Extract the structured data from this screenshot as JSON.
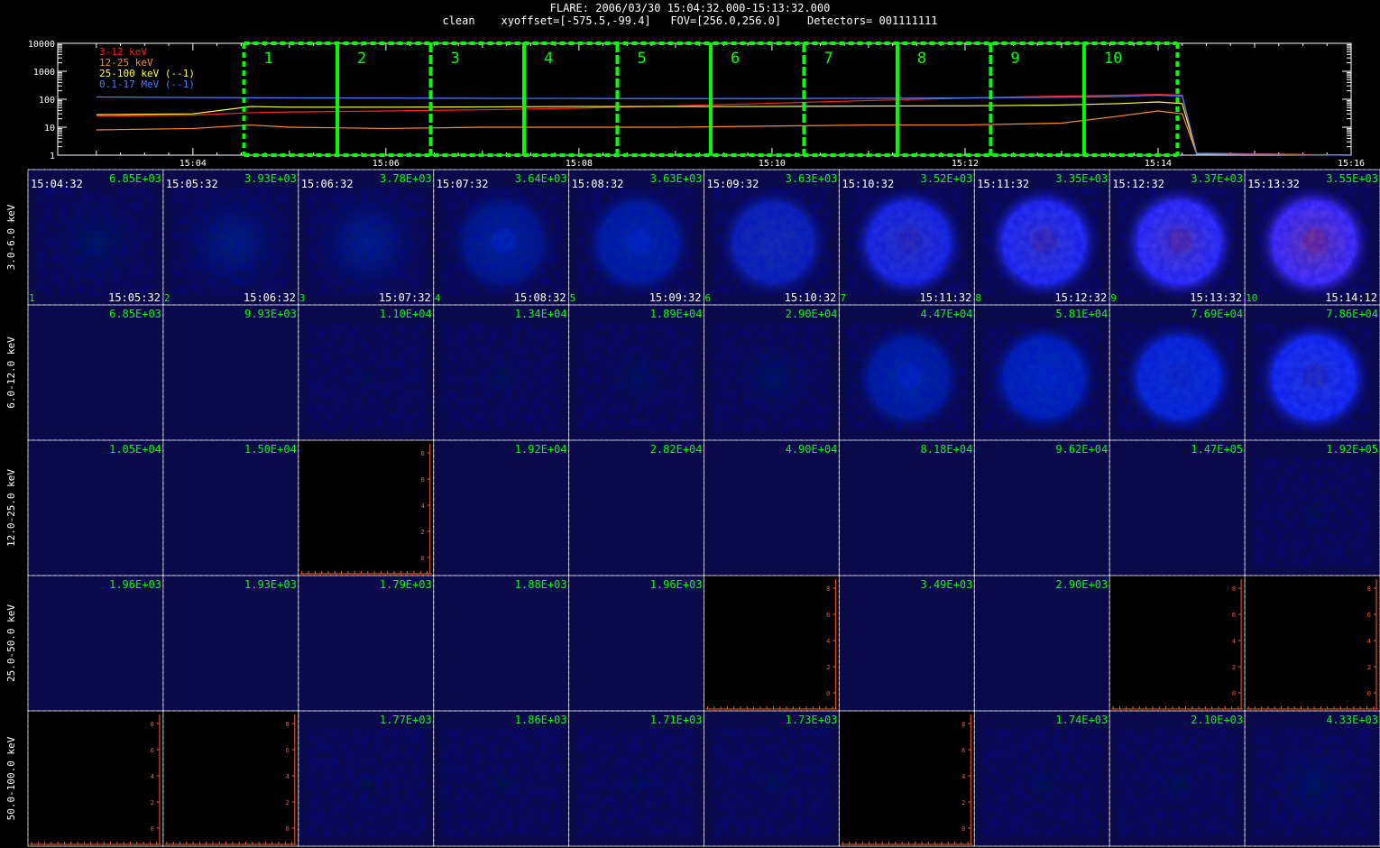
{
  "header": {
    "line1": "FLARE: 2006/03/30 15:04:32.000-15:13:32.000",
    "line2": "clean    xyoffset=[-575.5,-99.4]   FOV=[256.0,256.0]    Detectors= 001111111"
  },
  "colors": {
    "bg": "#000000",
    "green": "#00ff00",
    "red": "#ff2020",
    "orange": "#ff8c20",
    "yellow": "#ffff40",
    "blue": "#4a7cff",
    "imgbg": "#0a0a4a",
    "tick": "#ff5a20"
  },
  "chart_data": [
    {
      "type": "line",
      "yscale": "log",
      "ylim": [
        1,
        10000
      ],
      "yticks": [
        "10000",
        "1000",
        "100",
        "10",
        "1"
      ],
      "xticks": [
        "15:04",
        "15:06",
        "15:08",
        "15:10",
        "15:12",
        "15:14",
        "15:16"
      ],
      "x_minutes": [
        3.0,
        4.0,
        4.6,
        5.0,
        6.0,
        7.0,
        8.0,
        9.0,
        10.0,
        11.0,
        12.0,
        13.0,
        13.6,
        14.0,
        14.25,
        14.4,
        16.0
      ],
      "series": [
        {
          "name": "3-12 keV",
          "color": "#ff2020",
          "values": [
            25,
            27,
            33,
            35,
            38,
            42,
            48,
            58,
            72,
            90,
            110,
            130,
            140,
            150,
            140,
            1.2,
            1
          ]
        },
        {
          "name": "12-25 keV",
          "color": "#ff8c20",
          "values": [
            8,
            9,
            12,
            10,
            9,
            10,
            10,
            10,
            11,
            12,
            12,
            14,
            25,
            38,
            30,
            1.1,
            1
          ]
        },
        {
          "name": "25-100 keV (--1)",
          "color": "#ffff40",
          "values": [
            28,
            30,
            55,
            52,
            52,
            53,
            55,
            55,
            55,
            57,
            58,
            62,
            70,
            80,
            70,
            1.1,
            1
          ]
        },
        {
          "name": "0.1-17 MeV (--1)",
          "color": "#4a7cff",
          "values": [
            120,
            115,
            113,
            112,
            110,
            108,
            107,
            106,
            106,
            108,
            112,
            118,
            125,
            140,
            130,
            1.1,
            1
          ]
        }
      ],
      "intervals": [
        "1",
        "2",
        "3",
        "4",
        "5",
        "6",
        "7",
        "8",
        "9",
        "10"
      ]
    },
    {
      "type": "heatmap",
      "energy_bands": [
        "3.0-6.0 keV",
        "6.0-12.0 keV",
        "12.0-25.0 keV",
        "25.0-50.0 keV",
        "50.0-100.0 keV"
      ],
      "interval_numbers": [
        "1",
        "2",
        "3",
        "4",
        "5",
        "6",
        "7",
        "8",
        "9",
        "10"
      ],
      "start_times": [
        "15:04:32",
        "15:05:32",
        "15:06:32",
        "15:07:32",
        "15:08:32",
        "15:09:32",
        "15:10:32",
        "15:11:32",
        "15:12:32",
        "15:13:32"
      ],
      "end_times": [
        "15:05:32",
        "15:06:32",
        "15:07:32",
        "15:08:32",
        "15:09:32",
        "15:10:32",
        "15:11:32",
        "15:12:32",
        "15:13:32",
        "15:14:12"
      ],
      "peak_values": [
        [
          "6.85E+03",
          "3.93E+03",
          "3.78E+03",
          "3.64E+03",
          "3.63E+03",
          "3.63E+03",
          "3.52E+03",
          "3.35E+03",
          "3.37E+03",
          "3.55E+03"
        ],
        [
          "6.85E+03",
          "9.93E+03",
          "1.10E+04",
          "1.34E+04",
          "1.89E+04",
          "2.90E+04",
          "4.47E+04",
          "5.81E+04",
          "7.69E+04",
          "7.86E+04"
        ],
        [
          "1.05E+04",
          "1.50E+04",
          "",
          "1.92E+04",
          "2.82E+04",
          "4.90E+04",
          "8.18E+04",
          "9.62E+04",
          "1.47E+05",
          "1.92E+05"
        ],
        [
          "1.96E+03",
          "1.93E+03",
          "1.79E+03",
          "1.88E+03",
          "1.96E+03",
          "",
          "3.49E+03",
          "2.90E+03",
          "",
          ""
        ],
        [
          "",
          "",
          "1.77E+03",
          "1.86E+03",
          "1.71E+03",
          "1.73E+03",
          "",
          "1.74E+03",
          "2.10E+03",
          "4.33E+03"
        ]
      ],
      "empty_panels": [
        [
          2,
          2
        ],
        [
          3,
          5
        ],
        [
          3,
          8
        ],
        [
          3,
          9
        ],
        [
          4,
          0
        ],
        [
          4,
          1
        ],
        [
          4,
          6
        ]
      ],
      "axis_tick_labels": [
        "8",
        "6",
        "4",
        "2",
        "0"
      ],
      "image_level": [
        [
          0.15,
          0.3,
          0.35,
          0.45,
          0.55,
          0.65,
          0.85,
          0.95,
          1.0,
          1.0
        ],
        [
          0.0,
          0.0,
          0.02,
          0.05,
          0.08,
          0.12,
          0.55,
          0.65,
          0.8,
          0.95
        ],
        [
          0.0,
          0.0,
          0.0,
          0.0,
          0.0,
          0.0,
          0.0,
          0.0,
          0.0,
          0.03
        ],
        [
          0.0,
          0.0,
          0.0,
          0.0,
          0.0,
          0.0,
          0.0,
          0.0,
          0.0,
          0.0
        ],
        [
          0.0,
          0.0,
          0.03,
          0.03,
          0.03,
          0.04,
          0.0,
          0.04,
          0.05,
          0.12
        ]
      ],
      "image_red": [
        [
          0.0,
          0.0,
          0.0,
          0.0,
          0.0,
          0.15,
          0.3,
          0.4,
          0.55,
          0.75
        ],
        [
          0.0,
          0.0,
          0.0,
          0.0,
          0.0,
          0.0,
          0.0,
          0.0,
          0.1,
          0.25
        ],
        [
          0,
          0,
          0,
          0,
          0,
          0,
          0,
          0,
          0,
          0
        ],
        [
          0,
          0,
          0,
          0,
          0,
          0,
          0,
          0,
          0,
          0
        ],
        [
          0,
          0,
          0,
          0,
          0,
          0,
          0,
          0,
          0,
          0
        ]
      ]
    }
  ]
}
